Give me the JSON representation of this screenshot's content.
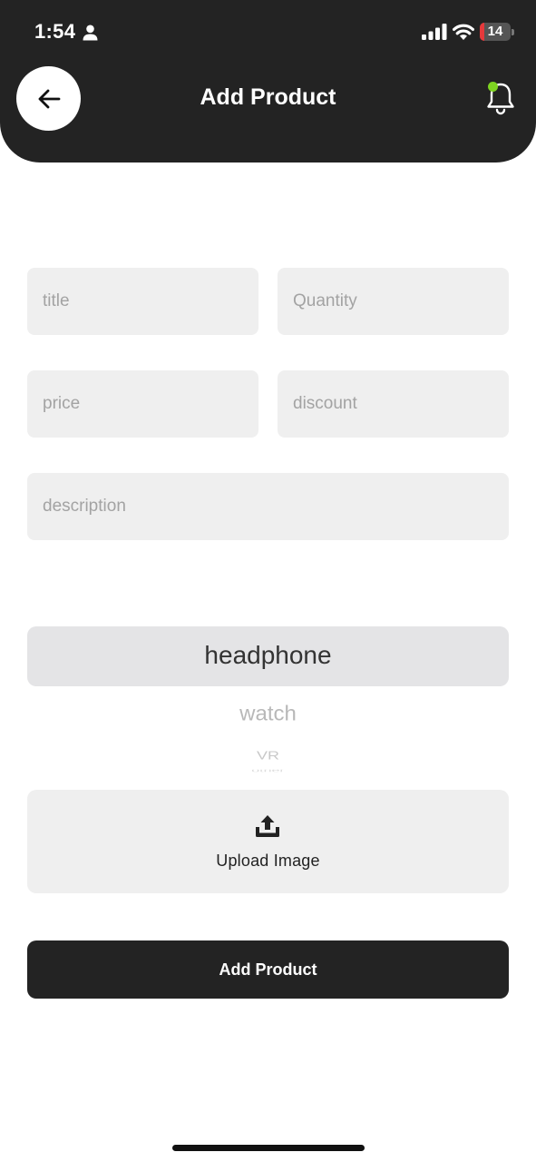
{
  "status_bar": {
    "time": "1:54",
    "battery_level": "14",
    "battery_fraction": 0.14,
    "icons": [
      "person-icon",
      "signal-icon",
      "wifi-icon",
      "battery-icon"
    ]
  },
  "header": {
    "title": "Add Product",
    "back_icon": "arrow-left-icon",
    "notification_icon": "bell-icon",
    "notification_dot_color": "#7ed321",
    "background_color": "#232323"
  },
  "form": {
    "title_placeholder": "title",
    "quantity_placeholder": "Quantity",
    "price_placeholder": "price",
    "discount_placeholder": "discount",
    "description_placeholder": "description"
  },
  "category_picker": {
    "selected": "headphone",
    "options_below": [
      "watch",
      "VR",
      "other"
    ]
  },
  "upload": {
    "label": "Upload Image",
    "icon": "upload-tray-icon"
  },
  "submit_button": {
    "label": "Add Product"
  }
}
